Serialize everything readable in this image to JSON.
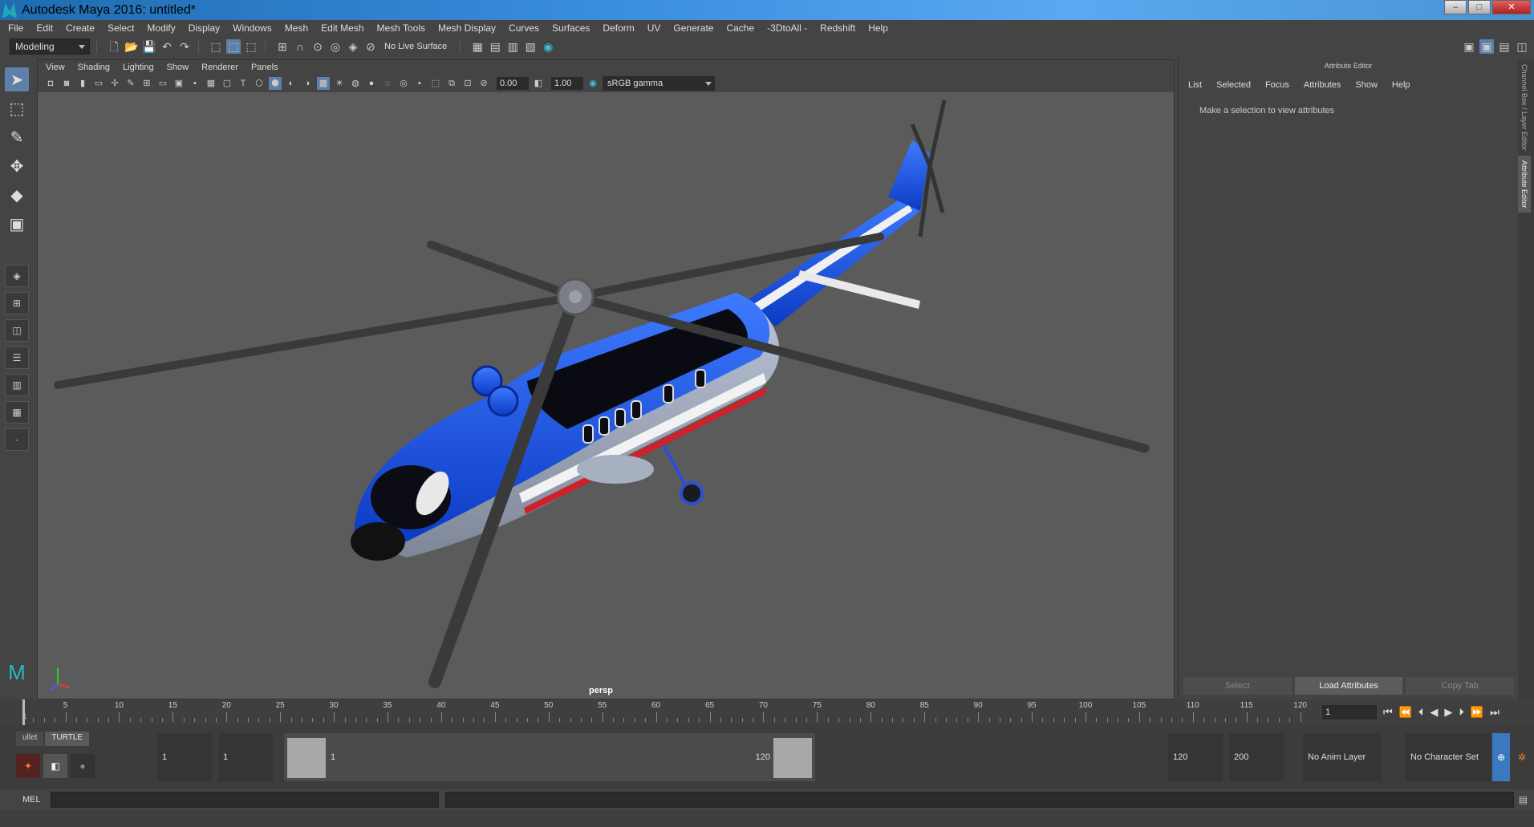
{
  "window": {
    "title": "Autodesk Maya 2016: untitled*"
  },
  "menubar": {
    "items": [
      "File",
      "Edit",
      "Create",
      "Select",
      "Modify",
      "Display",
      "Windows",
      "Mesh",
      "Edit Mesh",
      "Mesh Tools",
      "Mesh Display",
      "Curves",
      "Surfaces",
      "Deform",
      "UV",
      "Generate",
      "Cache",
      "-3DtoAll -",
      "Redshift",
      "Help"
    ]
  },
  "statusline": {
    "mode": "Modeling",
    "live_surface": "No Live Surface"
  },
  "viewport": {
    "menu": [
      "View",
      "Shading",
      "Lighting",
      "Show",
      "Renderer",
      "Panels"
    ],
    "exposure": "0.00",
    "gamma_value": "1.00",
    "color_space": "sRGB gamma",
    "camera_label": "persp"
  },
  "attribute_editor": {
    "title": "Attribute Editor",
    "menu": [
      "List",
      "Selected",
      "Focus",
      "Attributes",
      "Show",
      "Help"
    ],
    "message": "Make a selection to view attributes",
    "buttons": [
      "Select",
      "Load Attributes",
      "Copy Tab"
    ],
    "side_tabs": [
      "Channel Box / Layer Editor",
      "Attribute Editor"
    ]
  },
  "timeslider": {
    "start_label": "1",
    "ticks": [
      "5",
      "10",
      "15",
      "20",
      "25",
      "30",
      "35",
      "40",
      "45",
      "50",
      "55",
      "60",
      "65",
      "70",
      "75",
      "80",
      "85",
      "90",
      "95",
      "100",
      "105",
      "110",
      "115",
      "120"
    ],
    "current_frame": "1"
  },
  "range": {
    "shelf_tabs": [
      "ullet",
      "TURTLE"
    ],
    "start_time": "1",
    "playback_start": "1",
    "range_start_label": "1",
    "range_end_label": "120",
    "playback_end": "120",
    "end_time": "200",
    "anim_layer": "No Anim Layer",
    "character_set": "No Character Set"
  },
  "cmdline": {
    "label": "MEL"
  }
}
